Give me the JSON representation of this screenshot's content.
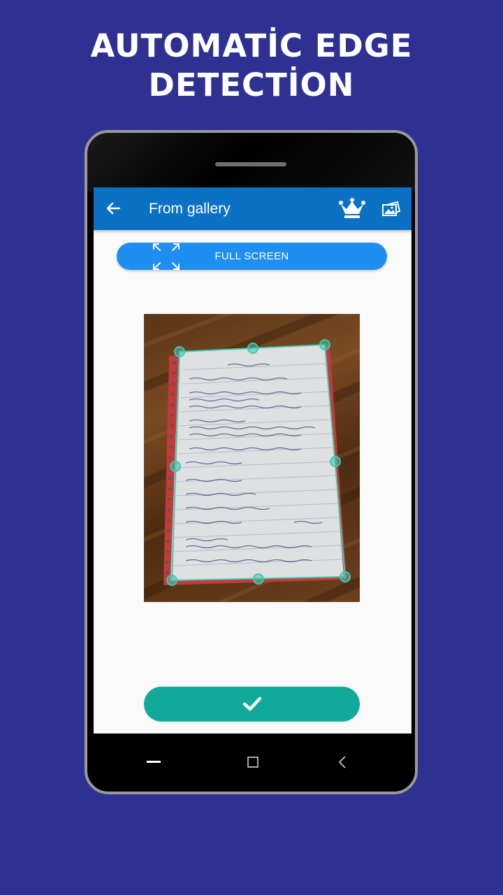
{
  "headline": {
    "line1": "AUTOMATİC EDGE",
    "line2": "DETECTİON"
  },
  "appbar": {
    "title": "From gallery",
    "back_icon": "arrow-left-icon",
    "premium_icon": "crown-icon",
    "gallery_icon": "gallery-icon"
  },
  "full_screen": {
    "label": "FULL SCREEN",
    "icon": "expand-icon"
  },
  "confirm": {
    "icon": "check-icon"
  },
  "navbar": {
    "recents_icon": "recents-icon",
    "home_icon": "home-square-icon",
    "back_icon": "back-triangle-icon"
  },
  "colors": {
    "background": "#2f3192",
    "appbar": "#0b71c5",
    "full_screen_button": "#1e8ef0",
    "confirm_button": "#11a99a",
    "edge_handle": "#3ec9b0"
  }
}
